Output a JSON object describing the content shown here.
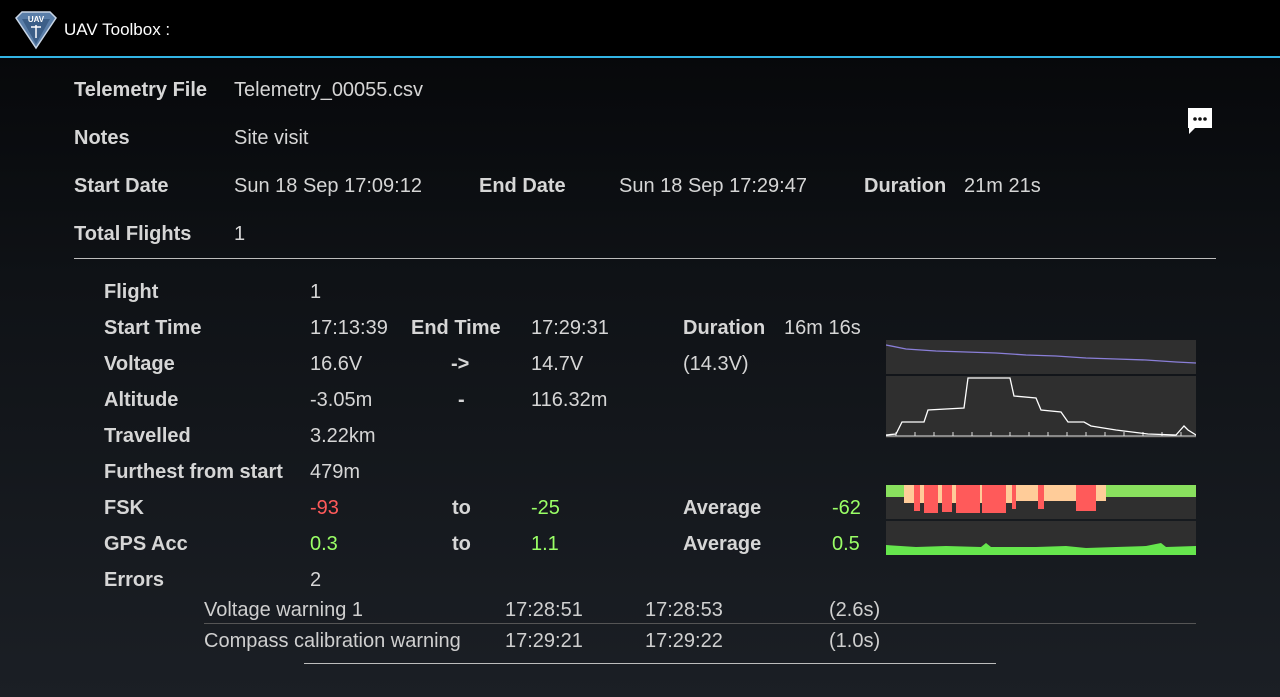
{
  "header": {
    "logo_text": "UAV",
    "title": "UAV Toolbox :"
  },
  "summary": {
    "telemetry_file_label": "Telemetry File",
    "telemetry_file": "Telemetry_00055.csv",
    "notes_label": "Notes",
    "notes": "Site visit",
    "start_date_label": "Start Date",
    "start_date": "Sun 18 Sep 17:09:12",
    "end_date_label": "End Date",
    "end_date": "Sun 18 Sep 17:29:47",
    "duration_label": "Duration",
    "duration": "21m 21s",
    "total_flights_label": "Total Flights",
    "total_flights": "1"
  },
  "flight": {
    "flight_label": "Flight",
    "flight": "1",
    "start_time_label": "Start Time",
    "start_time": "17:13:39",
    "end_time_label": "End Time",
    "end_time": "17:29:31",
    "duration_label": "Duration",
    "duration": "16m 16s",
    "voltage_label": "Voltage",
    "voltage_start": "16.6V",
    "voltage_arrow": "->",
    "voltage_end": "14.7V",
    "voltage_min": "(14.3V)",
    "altitude_label": "Altitude",
    "altitude_min": "-3.05m",
    "altitude_sep": "-",
    "altitude_max": "116.32m",
    "travelled_label": "Travelled",
    "travelled": "3.22km",
    "furthest_label": "Furthest from start",
    "furthest": "479m",
    "fsk_label": "FSK",
    "fsk_min": "-93",
    "fsk_to": "to",
    "fsk_max": "-25",
    "fsk_avg_label": "Average",
    "fsk_avg": "-62",
    "gps_label": "GPS Acc",
    "gps_min": "0.3",
    "gps_to": "to",
    "gps_max": "1.1",
    "gps_avg_label": "Average",
    "gps_avg": "0.5",
    "errors_label": "Errors",
    "errors": "2"
  },
  "errors": [
    {
      "name": "Voltage warning 1",
      "start": "17:28:51",
      "end": "17:28:53",
      "length": "(2.6s)"
    },
    {
      "name": "Compass calibration warning",
      "start": "17:29:21",
      "end": "17:29:22",
      "length": "(1.0s)"
    }
  ],
  "colors": {
    "accent": "#33b5e5",
    "bad": "#ff5a5a",
    "good": "#9aff66",
    "voltage_line": "#8a7fd8",
    "fsk_red": "#ff5a5a",
    "fsk_amber": "#ffcc99",
    "fsk_green": "#99ff66"
  },
  "icons": {
    "logo": "uav-shield-logo",
    "message": "chat-bubble-icon"
  }
}
